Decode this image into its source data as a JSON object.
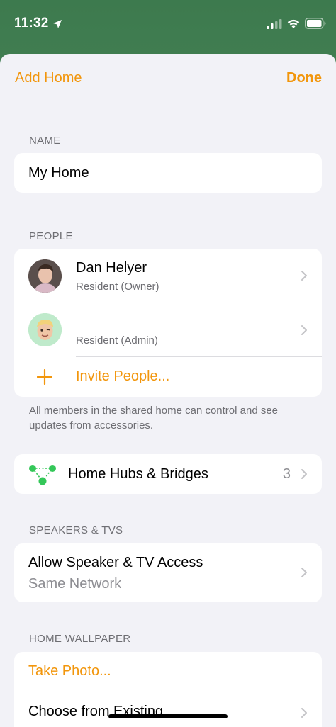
{
  "status_bar": {
    "time": "11:32",
    "icons": [
      "location-arrow-icon",
      "cellular-signal-icon",
      "wifi-icon",
      "battery-icon"
    ]
  },
  "nav": {
    "title_left": "Add Home",
    "done": "Done"
  },
  "name_section": {
    "header": "NAME",
    "value": "My Home"
  },
  "people_section": {
    "header": "PEOPLE",
    "people": [
      {
        "name": "Dan Helyer",
        "role": "Resident (Owner)"
      },
      {
        "name": "",
        "role": "Resident (Admin)"
      }
    ],
    "invite_label": "Invite People...",
    "footer": "All members in the shared home can control and see updates from accessories."
  },
  "hubs": {
    "label": "Home Hubs & Bridges",
    "count": "3"
  },
  "speakers_section": {
    "header": "SPEAKERS & TVS",
    "label": "Allow Speaker & TV Access",
    "value": "Same Network"
  },
  "wallpaper_section": {
    "header": "HOME WALLPAPER",
    "take_photo": "Take Photo...",
    "choose_existing": "Choose from Existing"
  },
  "colors": {
    "accent": "#f2960c",
    "background": "#f2f2f7",
    "secondary_text": "#6e6e73",
    "hub_green": "#34c759"
  }
}
